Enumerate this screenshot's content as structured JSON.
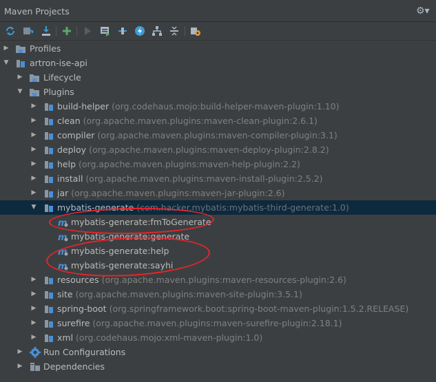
{
  "panel": {
    "title": "Maven Projects"
  },
  "toolbar": {
    "buttons": [
      "reimport-icon",
      "generate-sources-icon",
      "download-icon",
      "add-icon",
      "run-icon",
      "execute-goal-icon",
      "toggle-offline-icon",
      "skip-tests-icon",
      "show-dependencies-icon",
      "collapse-all-icon",
      "settings-icon"
    ]
  },
  "tree": {
    "profiles": "Profiles",
    "project": "artron-ise-api",
    "lifecycle": "Lifecycle",
    "plugins": "Plugins",
    "plugin_items": [
      {
        "name": "build-helper",
        "detail": "(org.codehaus.mojo:build-helper-maven-plugin:1.10)"
      },
      {
        "name": "clean",
        "detail": "(org.apache.maven.plugins:maven-clean-plugin:2.6.1)"
      },
      {
        "name": "compiler",
        "detail": "(org.apache.maven.plugins:maven-compiler-plugin:3.1)"
      },
      {
        "name": "deploy",
        "detail": "(org.apache.maven.plugins:maven-deploy-plugin:2.8.2)"
      },
      {
        "name": "help",
        "detail": "(org.apache.maven.plugins:maven-help-plugin:2.2)"
      },
      {
        "name": "install",
        "detail": "(org.apache.maven.plugins:maven-install-plugin:2.5.2)"
      },
      {
        "name": "jar",
        "detail": "(org.apache.maven.plugins:maven-jar-plugin:2.6)"
      },
      {
        "name": "mybatis-generate",
        "detail": "(com.hacker.mybatis:mybatis-third-generate:1.0)"
      }
    ],
    "goals": [
      "mybatis-generate:fmToGenerate",
      "mybatis-generate:generate",
      "mybatis-generate:help",
      "mybatis-generate:sayhi"
    ],
    "plugin_items_after": [
      {
        "name": "resources",
        "detail": "(org.apache.maven.plugins:maven-resources-plugin:2.6)"
      },
      {
        "name": "site",
        "detail": "(org.apache.maven.plugins:maven-site-plugin:3.5.1)"
      },
      {
        "name": "spring-boot",
        "detail": "(org.springframework.boot:spring-boot-maven-plugin:1.5.2.RELEASE)"
      },
      {
        "name": "surefire",
        "detail": "(org.apache.maven.plugins:maven-surefire-plugin:2.18.1)"
      },
      {
        "name": "xml",
        "detail": "(org.codehaus.mojo:xml-maven-plugin:1.0)"
      }
    ],
    "run_configurations": "Run Configurations",
    "dependencies": "Dependencies"
  },
  "colors": {
    "background": "#3c3f41",
    "selection": "#0d293e",
    "annotation": "#e8252b"
  }
}
